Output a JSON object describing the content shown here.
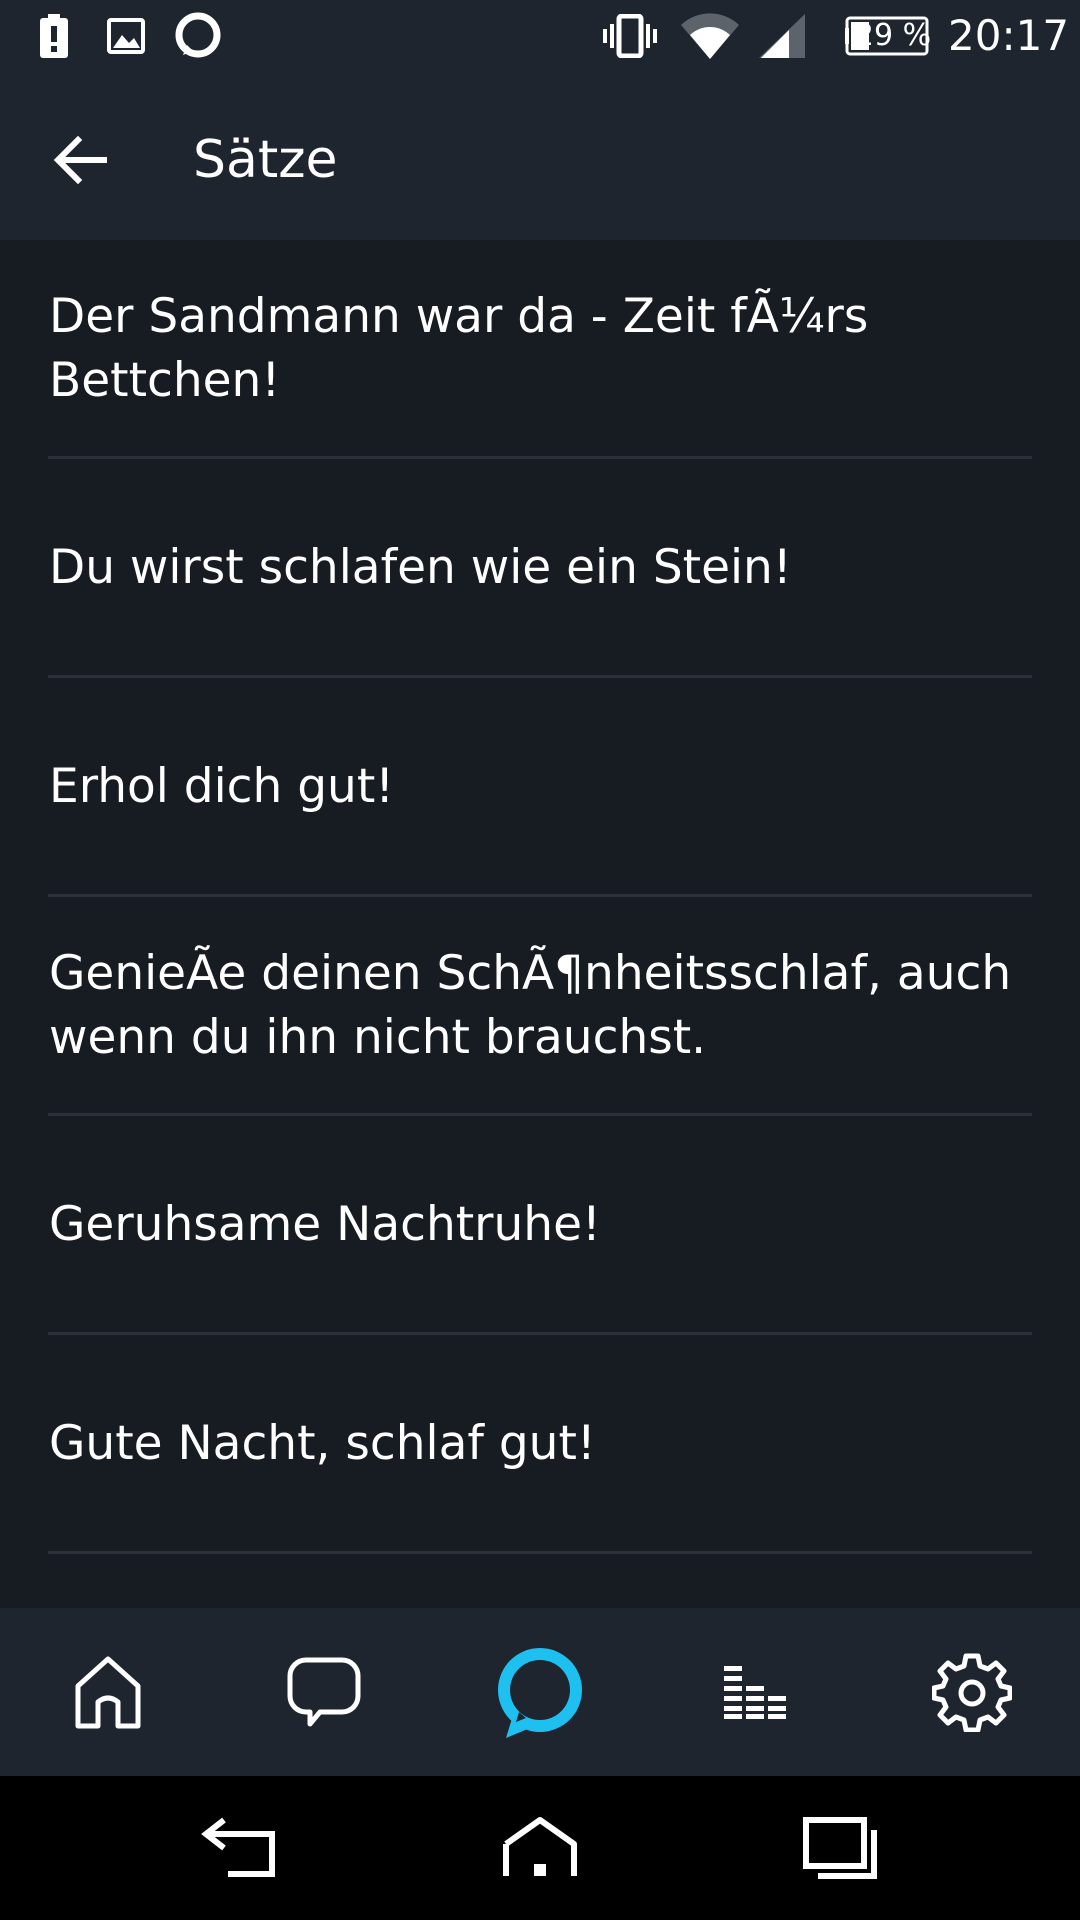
{
  "status_bar": {
    "battery_percent": "29 %",
    "time": "20:17",
    "icons": [
      "battery-alert-icon",
      "image-notification-icon",
      "alexa-notification-icon",
      "vibrate-icon",
      "wifi-icon",
      "cell-signal-icon",
      "battery-icon"
    ]
  },
  "app_bar": {
    "title": "Sätze",
    "back_icon": "arrow-left-icon"
  },
  "phrases": [
    "Der Sandmann war da - Zeit fÃ¼rs Bettchen!",
    "Du wirst schlafen wie ein Stein!",
    "Erhol dich gut!",
    "GenieÃe deinen SchÃ¶nheitsschlaf, auch wenn du ihn nicht brauchst.",
    "Geruhsame Nachtruhe!",
    "Gute Nacht, schlaf gut!"
  ],
  "bottom_nav": {
    "items": [
      "home-icon",
      "chat-icon",
      "alexa-icon",
      "music-icon",
      "settings-icon"
    ],
    "accent_color": "#1ec0f0"
  },
  "system_nav": {
    "items": [
      "back-icon",
      "home-icon",
      "recents-icon"
    ]
  },
  "colors": {
    "background": "#171b22",
    "bar": "#1f252e",
    "divider": "#2b313a",
    "text": "#ffffff",
    "alexa_blue": "#1ec0f0"
  }
}
